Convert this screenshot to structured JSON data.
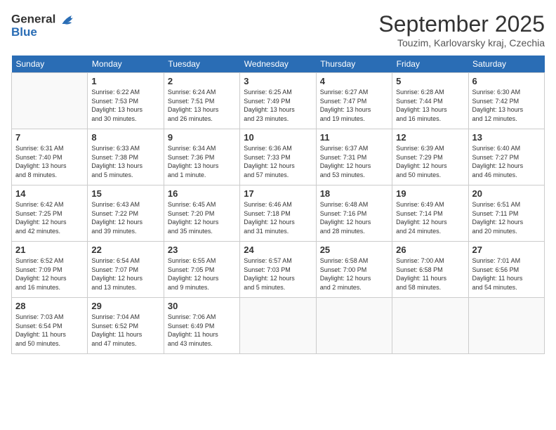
{
  "logo": {
    "line1": "General",
    "line2": "Blue"
  },
  "title": "September 2025",
  "location": "Touzim, Karlovarsky kraj, Czechia",
  "days_of_week": [
    "Sunday",
    "Monday",
    "Tuesday",
    "Wednesday",
    "Thursday",
    "Friday",
    "Saturday"
  ],
  "weeks": [
    [
      {
        "day": "",
        "info": ""
      },
      {
        "day": "1",
        "info": "Sunrise: 6:22 AM\nSunset: 7:53 PM\nDaylight: 13 hours\nand 30 minutes."
      },
      {
        "day": "2",
        "info": "Sunrise: 6:24 AM\nSunset: 7:51 PM\nDaylight: 13 hours\nand 26 minutes."
      },
      {
        "day": "3",
        "info": "Sunrise: 6:25 AM\nSunset: 7:49 PM\nDaylight: 13 hours\nand 23 minutes."
      },
      {
        "day": "4",
        "info": "Sunrise: 6:27 AM\nSunset: 7:47 PM\nDaylight: 13 hours\nand 19 minutes."
      },
      {
        "day": "5",
        "info": "Sunrise: 6:28 AM\nSunset: 7:44 PM\nDaylight: 13 hours\nand 16 minutes."
      },
      {
        "day": "6",
        "info": "Sunrise: 6:30 AM\nSunset: 7:42 PM\nDaylight: 13 hours\nand 12 minutes."
      }
    ],
    [
      {
        "day": "7",
        "info": "Sunrise: 6:31 AM\nSunset: 7:40 PM\nDaylight: 13 hours\nand 8 minutes."
      },
      {
        "day": "8",
        "info": "Sunrise: 6:33 AM\nSunset: 7:38 PM\nDaylight: 13 hours\nand 5 minutes."
      },
      {
        "day": "9",
        "info": "Sunrise: 6:34 AM\nSunset: 7:36 PM\nDaylight: 13 hours\nand 1 minute."
      },
      {
        "day": "10",
        "info": "Sunrise: 6:36 AM\nSunset: 7:33 PM\nDaylight: 12 hours\nand 57 minutes."
      },
      {
        "day": "11",
        "info": "Sunrise: 6:37 AM\nSunset: 7:31 PM\nDaylight: 12 hours\nand 53 minutes."
      },
      {
        "day": "12",
        "info": "Sunrise: 6:39 AM\nSunset: 7:29 PM\nDaylight: 12 hours\nand 50 minutes."
      },
      {
        "day": "13",
        "info": "Sunrise: 6:40 AM\nSunset: 7:27 PM\nDaylight: 12 hours\nand 46 minutes."
      }
    ],
    [
      {
        "day": "14",
        "info": "Sunrise: 6:42 AM\nSunset: 7:25 PM\nDaylight: 12 hours\nand 42 minutes."
      },
      {
        "day": "15",
        "info": "Sunrise: 6:43 AM\nSunset: 7:22 PM\nDaylight: 12 hours\nand 39 minutes."
      },
      {
        "day": "16",
        "info": "Sunrise: 6:45 AM\nSunset: 7:20 PM\nDaylight: 12 hours\nand 35 minutes."
      },
      {
        "day": "17",
        "info": "Sunrise: 6:46 AM\nSunset: 7:18 PM\nDaylight: 12 hours\nand 31 minutes."
      },
      {
        "day": "18",
        "info": "Sunrise: 6:48 AM\nSunset: 7:16 PM\nDaylight: 12 hours\nand 28 minutes."
      },
      {
        "day": "19",
        "info": "Sunrise: 6:49 AM\nSunset: 7:14 PM\nDaylight: 12 hours\nand 24 minutes."
      },
      {
        "day": "20",
        "info": "Sunrise: 6:51 AM\nSunset: 7:11 PM\nDaylight: 12 hours\nand 20 minutes."
      }
    ],
    [
      {
        "day": "21",
        "info": "Sunrise: 6:52 AM\nSunset: 7:09 PM\nDaylight: 12 hours\nand 16 minutes."
      },
      {
        "day": "22",
        "info": "Sunrise: 6:54 AM\nSunset: 7:07 PM\nDaylight: 12 hours\nand 13 minutes."
      },
      {
        "day": "23",
        "info": "Sunrise: 6:55 AM\nSunset: 7:05 PM\nDaylight: 12 hours\nand 9 minutes."
      },
      {
        "day": "24",
        "info": "Sunrise: 6:57 AM\nSunset: 7:03 PM\nDaylight: 12 hours\nand 5 minutes."
      },
      {
        "day": "25",
        "info": "Sunrise: 6:58 AM\nSunset: 7:00 PM\nDaylight: 12 hours\nand 2 minutes."
      },
      {
        "day": "26",
        "info": "Sunrise: 7:00 AM\nSunset: 6:58 PM\nDaylight: 11 hours\nand 58 minutes."
      },
      {
        "day": "27",
        "info": "Sunrise: 7:01 AM\nSunset: 6:56 PM\nDaylight: 11 hours\nand 54 minutes."
      }
    ],
    [
      {
        "day": "28",
        "info": "Sunrise: 7:03 AM\nSunset: 6:54 PM\nDaylight: 11 hours\nand 50 minutes."
      },
      {
        "day": "29",
        "info": "Sunrise: 7:04 AM\nSunset: 6:52 PM\nDaylight: 11 hours\nand 47 minutes."
      },
      {
        "day": "30",
        "info": "Sunrise: 7:06 AM\nSunset: 6:49 PM\nDaylight: 11 hours\nand 43 minutes."
      },
      {
        "day": "",
        "info": ""
      },
      {
        "day": "",
        "info": ""
      },
      {
        "day": "",
        "info": ""
      },
      {
        "day": "",
        "info": ""
      }
    ]
  ]
}
